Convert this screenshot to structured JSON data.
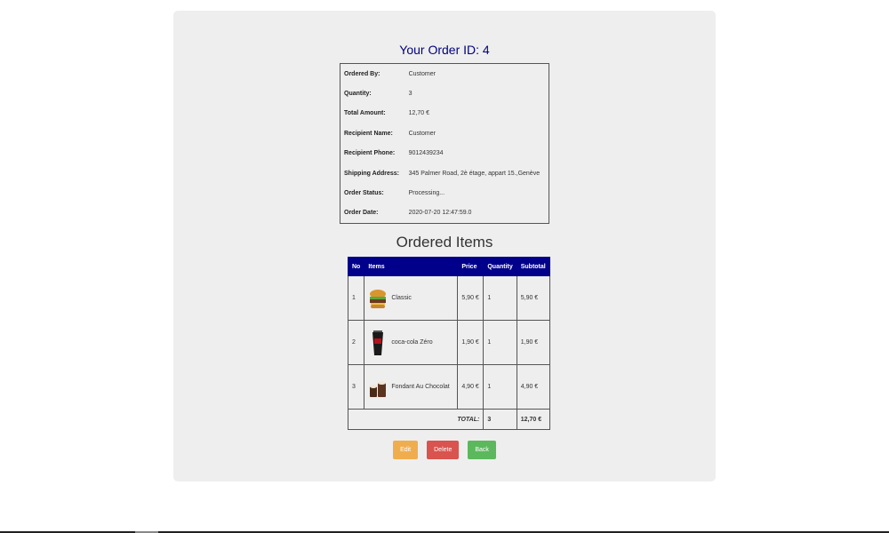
{
  "order": {
    "title": "Your Order ID: 4",
    "fields": [
      {
        "label": "Ordered By:",
        "value": "Customer"
      },
      {
        "label": "Quantity:",
        "value": "3"
      },
      {
        "label": "Total Amount:",
        "value": "12,70 €"
      },
      {
        "label": "Recipient Name:",
        "value": "Customer"
      },
      {
        "label": "Recipient Phone:",
        "value": "9012439234"
      },
      {
        "label": "Shipping Address:",
        "value": "345 Palmer Road, 2è étage, appart 15.,Genève"
      },
      {
        "label": "Order Status:",
        "value": "Processing..."
      },
      {
        "label": "Order Date:",
        "value": "2020-07-20 12:47:59.0"
      }
    ]
  },
  "items_section": {
    "title": "Ordered Items",
    "headers": [
      "No",
      "Items",
      "Price",
      "Quantity",
      "Subtotal"
    ],
    "rows": [
      {
        "no": "1",
        "name": "Classic",
        "icon": "burger-icon",
        "price": "5,90 €",
        "quantity": "1",
        "subtotal": "5,90 €"
      },
      {
        "no": "2",
        "name": "coca-cola Zéro",
        "icon": "cola-cup-icon",
        "price": "1,90 €",
        "quantity": "1",
        "subtotal": "1,90 €"
      },
      {
        "no": "3",
        "name": "Fondant Au Chocolat",
        "icon": "chocolate-fondant-icon",
        "price": "4,90 €",
        "quantity": "1",
        "subtotal": "4,90 €"
      }
    ],
    "total_label": "TOTAL:",
    "total_quantity": "3",
    "total_amount": "12,70 €"
  },
  "actions": {
    "edit_label": "Edit",
    "delete_label": "Delete",
    "back_label": "Back"
  },
  "colors": {
    "card_bg": "#eeeeee",
    "title": "#000080",
    "table_header": "#00008b",
    "edit": "#f0ad4e",
    "delete": "#d9534f",
    "back": "#5cb85c"
  }
}
